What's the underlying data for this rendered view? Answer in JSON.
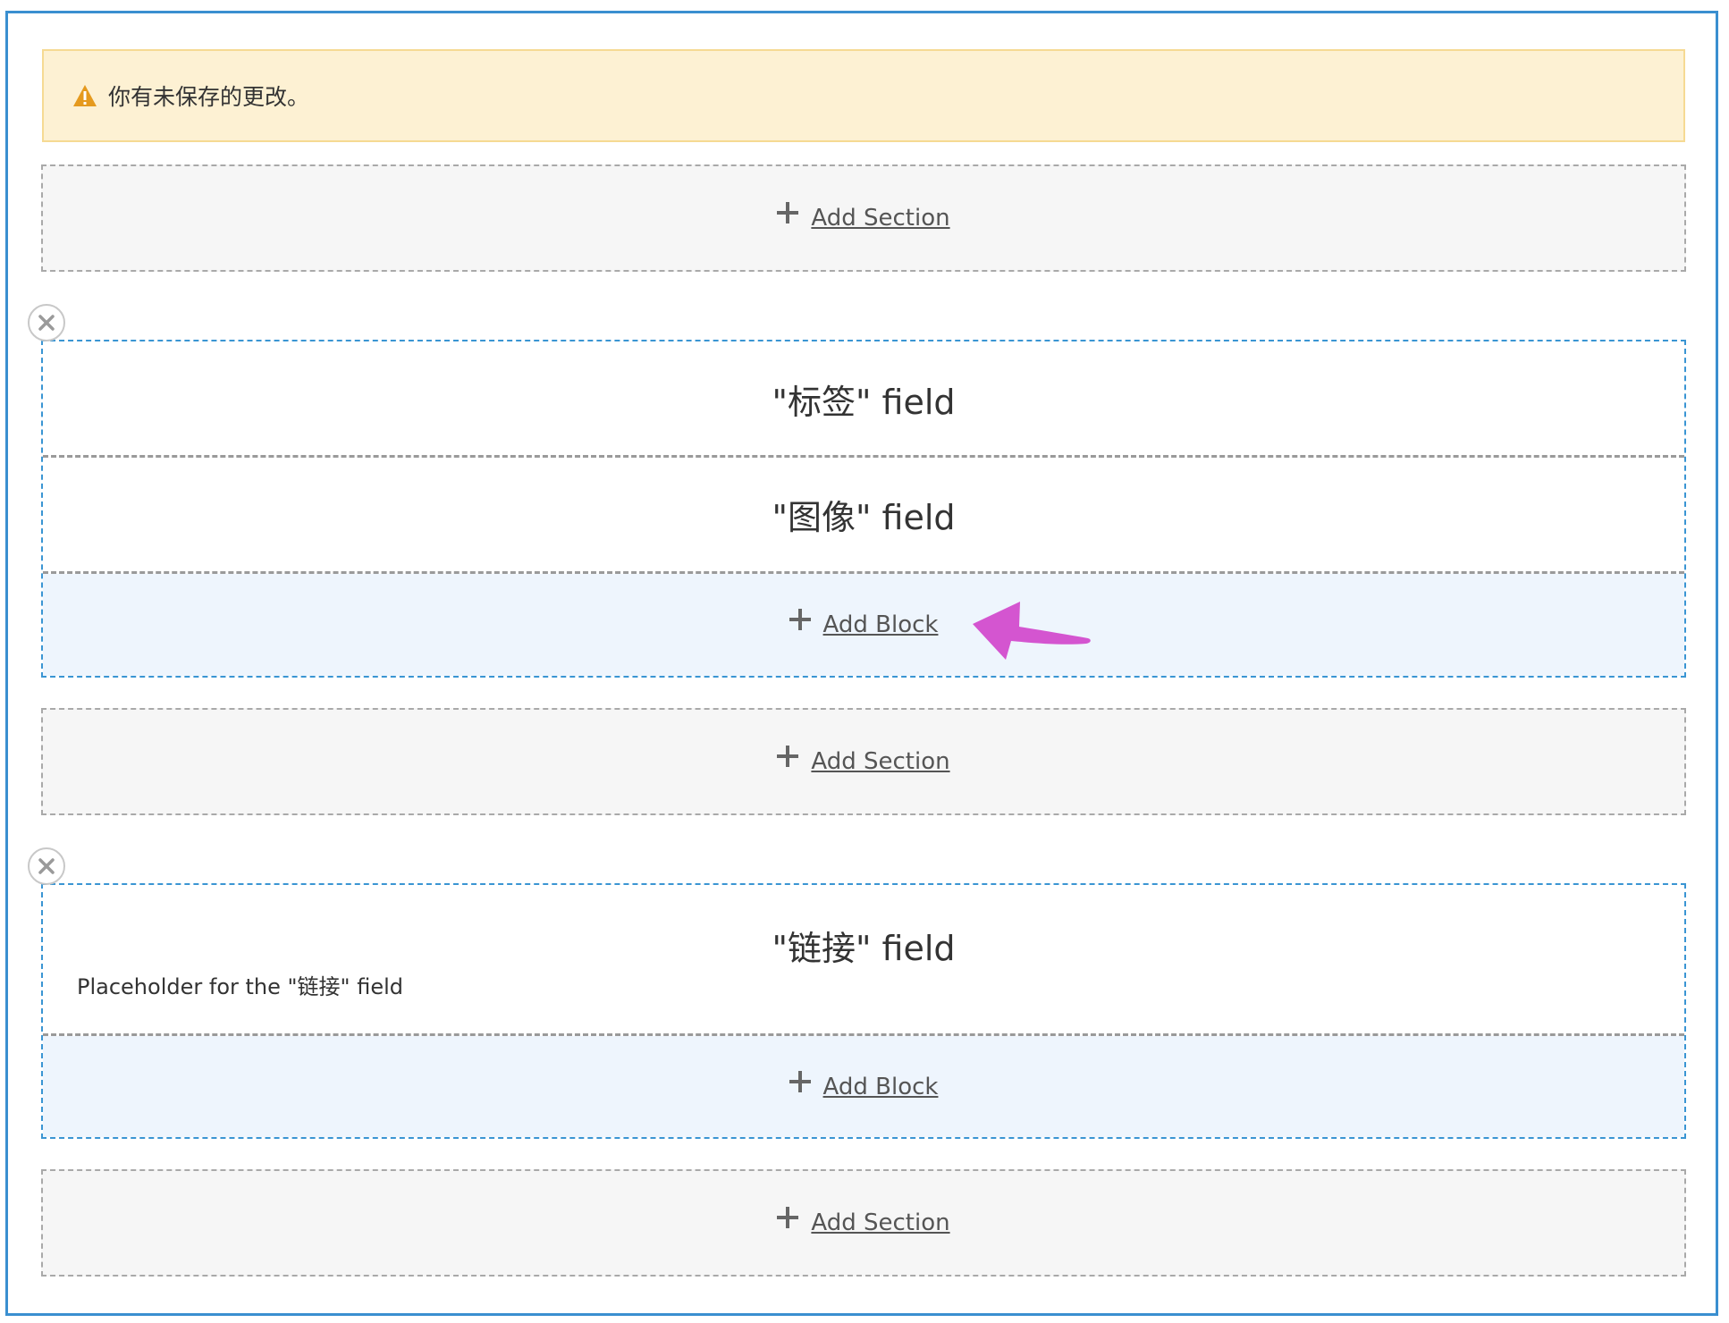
{
  "warning": {
    "message": "你有未保存的更改。"
  },
  "add_section_label": "Add Section",
  "add_block_label": "Add Block",
  "sections": [
    {
      "blocks": [
        {
          "title": "\"标签\" field"
        },
        {
          "title": "\"图像\" field"
        }
      ]
    },
    {
      "blocks": [
        {
          "title": "\"链接\" field",
          "placeholder": "Placeholder for the \"链接\" field"
        }
      ]
    }
  ],
  "colors": {
    "frame_border": "#3a8fd0",
    "warning_bg": "#fdf1d3",
    "section_border": "#3a95d3",
    "add_block_bg": "#eef5fd",
    "annotation_arrow": "#d455d0"
  },
  "icons": {
    "warning": "warning-triangle-icon",
    "remove": "close-circle-icon",
    "add": "plus-icon",
    "annotation": "annotation-arrow-icon"
  }
}
